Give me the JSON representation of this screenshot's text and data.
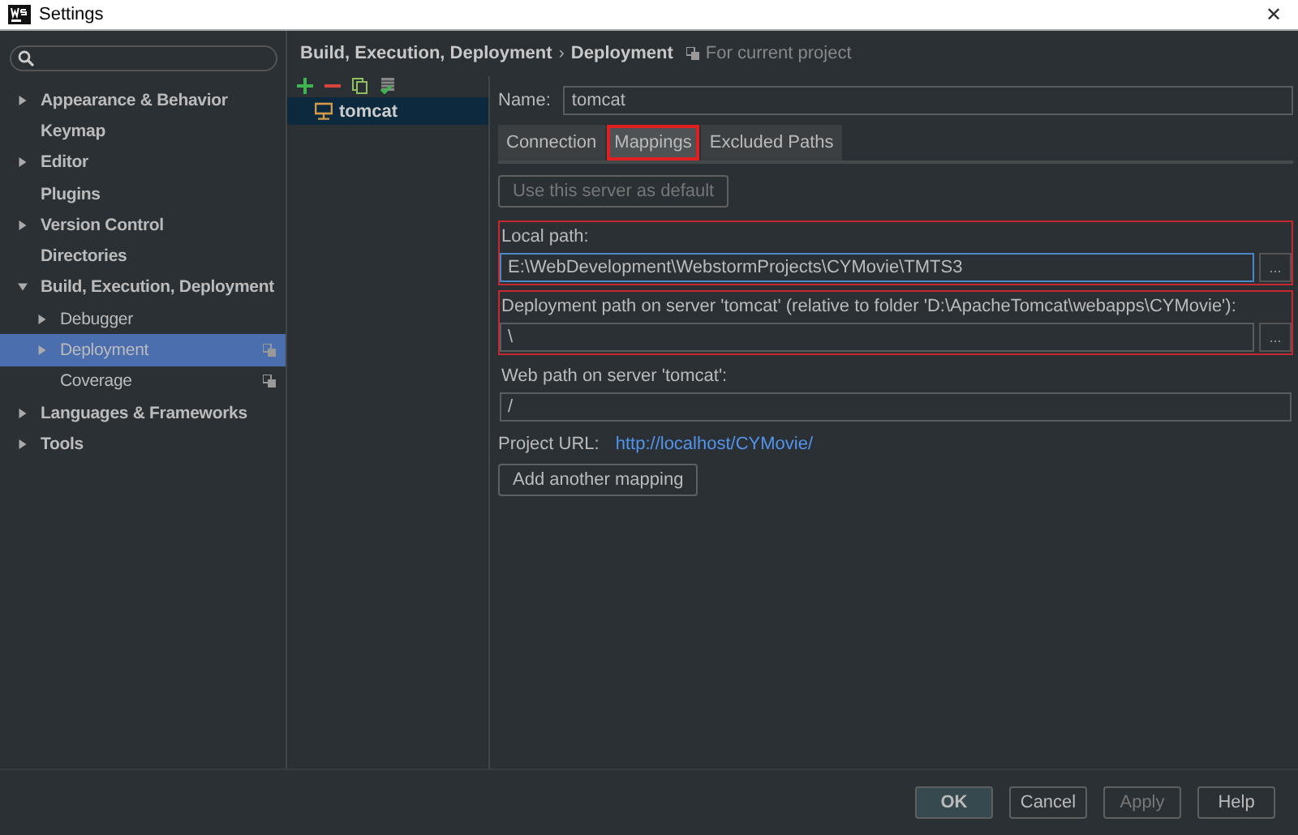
{
  "window": {
    "title": "Settings",
    "close": "✕"
  },
  "sidebar": {
    "items": [
      {
        "label": "Appearance & Behavior",
        "expandable": true,
        "expanded": false,
        "selected": false,
        "project_scoped": false
      },
      {
        "label": "Keymap",
        "expandable": false,
        "selected": false,
        "project_scoped": false
      },
      {
        "label": "Editor",
        "expandable": true,
        "expanded": false,
        "selected": false,
        "project_scoped": false
      },
      {
        "label": "Plugins",
        "expandable": false,
        "selected": false,
        "project_scoped": false
      },
      {
        "label": "Version Control",
        "expandable": true,
        "expanded": false,
        "selected": false,
        "project_scoped": false
      },
      {
        "label": "Directories",
        "expandable": false,
        "selected": false,
        "project_scoped": false
      },
      {
        "label": "Build, Execution, Deployment",
        "expandable": true,
        "expanded": true,
        "selected": false,
        "project_scoped": false,
        "children": [
          {
            "label": "Debugger",
            "expandable": true,
            "expanded": false,
            "selected": false,
            "project_scoped": false
          },
          {
            "label": "Deployment",
            "expandable": true,
            "expanded": false,
            "selected": true,
            "project_scoped": true
          },
          {
            "label": "Coverage",
            "expandable": false,
            "selected": false,
            "project_scoped": true
          }
        ]
      },
      {
        "label": "Languages & Frameworks",
        "expandable": true,
        "expanded": false,
        "selected": false,
        "project_scoped": false
      },
      {
        "label": "Tools",
        "expandable": true,
        "expanded": false,
        "selected": false,
        "project_scoped": false
      }
    ]
  },
  "breadcrumb": {
    "parent": "Build, Execution, Deployment",
    "separator": "›",
    "current": "Deployment",
    "scope": "For current project"
  },
  "servers": {
    "items": [
      {
        "label": "tomcat",
        "selected": true
      }
    ]
  },
  "name_field": {
    "label": "Name:",
    "value": "tomcat"
  },
  "tabs": [
    {
      "label": "Connection",
      "selected": false,
      "highlighted": false
    },
    {
      "label": "Mappings",
      "selected": true,
      "highlighted": true
    },
    {
      "label": "Excluded Paths",
      "selected": false,
      "highlighted": false
    }
  ],
  "default_button": {
    "label": "Use this server as default",
    "disabled": true
  },
  "mappings": [
    {
      "label": "Local path:",
      "value": "E:\\WebDevelopment\\WebstormProjects\\CYMovie\\TMTS3",
      "browse": "...",
      "focused": true,
      "highlighted": true
    },
    {
      "label": "Deployment path on server 'tomcat' (relative to folder 'D:\\ApacheTomcat\\webapps\\CYMovie'):",
      "value": "\\",
      "browse": "...",
      "focused": false,
      "highlighted": true
    },
    {
      "label": "Web path on server 'tomcat':",
      "value": "/",
      "focused": false,
      "highlighted": false
    }
  ],
  "project_url": {
    "label": "Project URL:",
    "link": "http://localhost/CYMovie/"
  },
  "add_button": {
    "label": "Add another mapping"
  },
  "buttons": [
    {
      "label": "OK",
      "default": true,
      "disabled": false
    },
    {
      "label": "Cancel",
      "default": false,
      "disabled": false
    },
    {
      "label": "Apply",
      "default": false,
      "disabled": true
    },
    {
      "label": "Help",
      "default": false,
      "disabled": false
    }
  ]
}
